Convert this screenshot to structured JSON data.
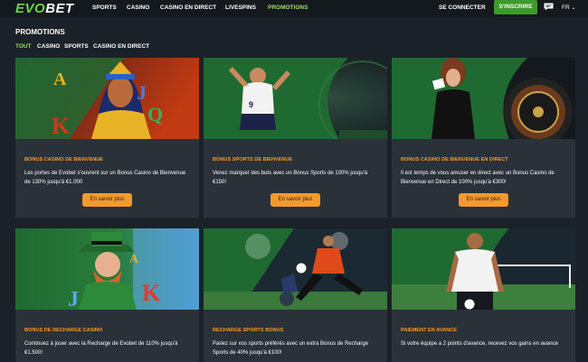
{
  "brand": {
    "logo_prefix": "EVO",
    "logo_suffix": "BET"
  },
  "nav": {
    "items": [
      {
        "label": "SPORTS"
      },
      {
        "label": "CASINO"
      },
      {
        "label": "CASINO EN DIRECT"
      },
      {
        "label": "LIVESPINS"
      },
      {
        "label": "PROMOTIONS"
      }
    ],
    "active": "PROMOTIONS",
    "login_label": "SE CONNECTER",
    "register_label": "S'INSCRIRE",
    "chat_icon": "chat-icon",
    "language": "FR"
  },
  "page": {
    "title": "PROMOTIONS",
    "filters": [
      {
        "label": "TOUT"
      },
      {
        "label": "CASINO"
      },
      {
        "label": "SPORTS"
      },
      {
        "label": "CASINO EN DIRECT"
      }
    ],
    "active_filter": "TOUT"
  },
  "promotions": [
    {
      "title": "BONUS CASINO DE BIENVENUE",
      "description": "Les portes de Evobet s'ouvrent sur un Bonus Casino de Bienvenue de 130% jusqu'à €1.000",
      "button": "En savoir plus",
      "image": "egyptian-queen-slot-art"
    },
    {
      "title": "BONUS SPORTS DE BIENVENUE",
      "description": "Venez marquer des buts avec un Bonus Sports de 100% jusqu'à €150!",
      "button": "En savoir plus",
      "image": "football-player-celebrating"
    },
    {
      "title": "BONUS CASINO DE BIENVENUE EN DIRECT",
      "description": "Il est temps de vous amuser en direct avec un Bonus Casino de Bienvenue en Direct de 100% jusqu'à €300!",
      "button": "En savoir plus",
      "image": "live-roulette-dealer"
    },
    {
      "title": "BONUS DE RECHARGE CASINO",
      "description": "Continuez à jouer avec la Recharge de Evobet de 110% jusqu'à €1.500!",
      "image": "leprechaun-slot-art"
    },
    {
      "title": "RECHARGE SPORTS BONUS",
      "description": "Pariez sur vos sports préférés avec un extra Bonus de Recharge Sports de 40% jusqu'à €100!",
      "image": "football-player-kicking"
    },
    {
      "title": "PAIEMENT EN AVANCE",
      "description": "Si votre équipe a 2 points d'avance, recevez vos gains en avance",
      "image": "footballer-facing-goal"
    }
  ],
  "colors": {
    "page_bg": "#1b2128",
    "topbar_bg": "#14191e",
    "card_bg": "#2a3139",
    "accent_green": "#3e9a2d",
    "active_green": "#8fe06a",
    "title_orange": "#ff9a1e",
    "button_orange": "#f39a2c"
  }
}
